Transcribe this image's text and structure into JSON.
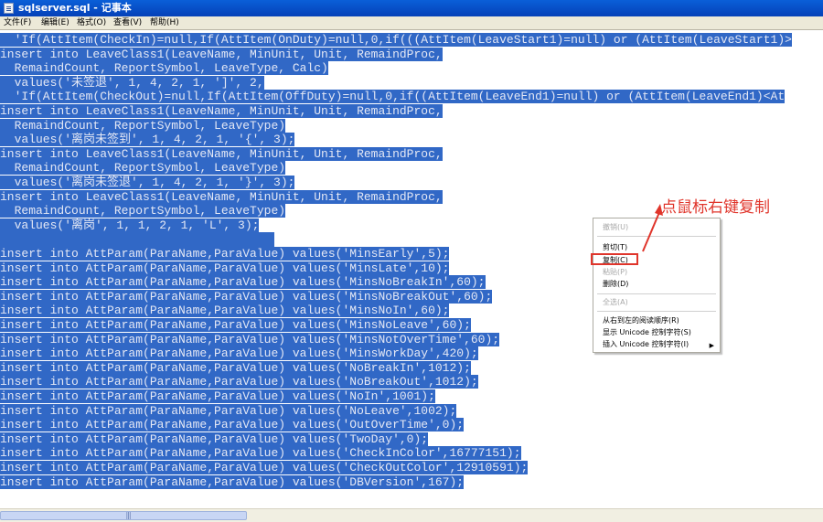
{
  "window": {
    "title": "sqlserver.sql - 记事本"
  },
  "menubar": [
    {
      "label": "文件(F)"
    },
    {
      "label": "编辑(E)"
    },
    {
      "label": "格式(O)"
    },
    {
      "label": "查看(V)"
    },
    {
      "label": "帮助(H)"
    }
  ],
  "editor": {
    "lines": [
      {
        "text": "  'If(AttItem(CheckIn)=null,If(AttItem(OnDuty)=null,0,if(((AttItem(LeaveStart1)=null) or (AttItem(LeaveStart1)>",
        "selected": true
      },
      {
        "text": "insert into LeaveClass1(LeaveName, MinUnit, Unit, RemaindProc,",
        "selected": true
      },
      {
        "text": "  RemaindCount, ReportSymbol, LeaveType, Calc)",
        "selected": true
      },
      {
        "text": "  values('未签退', 1, 4, 2, 1, ']', 2,",
        "selected": true
      },
      {
        "text": "  'If(AttItem(CheckOut)=null,If(AttItem(OffDuty)=null,0,if((AttItem(LeaveEnd1)=null) or (AttItem(LeaveEnd1)<At",
        "selected": true
      },
      {
        "text": "insert into LeaveClass1(LeaveName, MinUnit, Unit, RemaindProc,",
        "selected": true
      },
      {
        "text": "  RemaindCount, ReportSymbol, LeaveType)",
        "selected": true
      },
      {
        "text": "  values('离岗未签到', 1, 4, 2, 1, '{', 3);",
        "selected": true
      },
      {
        "text": "insert into LeaveClass1(LeaveName, MinUnit, Unit, RemaindProc,",
        "selected": true
      },
      {
        "text": "  RemaindCount, ReportSymbol, LeaveType)",
        "selected": true
      },
      {
        "text": "  values('离岗未签退', 1, 4, 2, 1, '}', 3);",
        "selected": true
      },
      {
        "text": "insert into LeaveClass1(LeaveName, MinUnit, Unit, RemaindProc,",
        "selected": true
      },
      {
        "text": "  RemaindCount, ReportSymbol, LeaveType)",
        "selected": true
      },
      {
        "text": "  values('离岗', 1, 1, 2, 1, 'L', 3);",
        "selected": true
      },
      {
        "text": "",
        "selected": true
      },
      {
        "text": "insert into AttParam(ParaName,ParaValue) values('MinsEarly',5);",
        "selected": true
      },
      {
        "text": "insert into AttParam(ParaName,ParaValue) values('MinsLate',10);",
        "selected": true
      },
      {
        "text": "insert into AttParam(ParaName,ParaValue) values('MinsNoBreakIn',60);",
        "selected": true
      },
      {
        "text": "insert into AttParam(ParaName,ParaValue) values('MinsNoBreakOut',60);",
        "selected": true
      },
      {
        "text": "insert into AttParam(ParaName,ParaValue) values('MinsNoIn',60);",
        "selected": true
      },
      {
        "text": "insert into AttParam(ParaName,ParaValue) values('MinsNoLeave',60);",
        "selected": true
      },
      {
        "text": "insert into AttParam(ParaName,ParaValue) values('MinsNotOverTime',60);",
        "selected": true
      },
      {
        "text": "insert into AttParam(ParaName,ParaValue) values('MinsWorkDay',420);",
        "selected": true
      },
      {
        "text": "insert into AttParam(ParaName,ParaValue) values('NoBreakIn',1012);",
        "selected": true
      },
      {
        "text": "insert into AttParam(ParaName,ParaValue) values('NoBreakOut',1012);",
        "selected": true
      },
      {
        "text": "insert into AttParam(ParaName,ParaValue) values('NoIn',1001);",
        "selected": true
      },
      {
        "text": "insert into AttParam(ParaName,ParaValue) values('NoLeave',1002);",
        "selected": true
      },
      {
        "text": "insert into AttParam(ParaName,ParaValue) values('OutOverTime',0);",
        "selected": true
      },
      {
        "text": "insert into AttParam(ParaName,ParaValue) values('TwoDay',0);",
        "selected": true
      },
      {
        "text": "insert into AttParam(ParaName,ParaValue) values('CheckInColor',16777151);",
        "selected": true
      },
      {
        "text": "insert into AttParam(ParaName,ParaValue) values('CheckOutColor',12910591);",
        "selected": true
      },
      {
        "text": "insert into AttParam(ParaName,ParaValue) values('DBVersion',167);",
        "selected": true
      }
    ]
  },
  "context_menu": {
    "items": [
      {
        "label": "撤销(U)",
        "disabled": true
      },
      {
        "separator": true
      },
      {
        "label": "剪切(T)",
        "disabled": false
      },
      {
        "label": "复制(C)",
        "disabled": false,
        "highlighted": true
      },
      {
        "label": "粘贴(P)",
        "disabled": true
      },
      {
        "label": "删除(D)",
        "disabled": false
      },
      {
        "separator": true
      },
      {
        "label": "全选(A)",
        "disabled": true
      },
      {
        "separator": true
      },
      {
        "label": "从右到左的阅读顺序(R)",
        "disabled": false
      },
      {
        "label": "显示 Unicode 控制字符(S)",
        "disabled": false
      },
      {
        "label": "插入 Unicode 控制字符(I)",
        "disabled": false,
        "submenu": true
      }
    ],
    "submenu_arrow": "▶"
  },
  "annotation": {
    "text": "点鼠标右键复制",
    "color": "#e0352b"
  },
  "scrollbar": {
    "thumb_grip": "|||"
  },
  "colors": {
    "selection": "#3168c6",
    "titlebar": "#0a5fd8",
    "annotation": "#e0352b"
  }
}
